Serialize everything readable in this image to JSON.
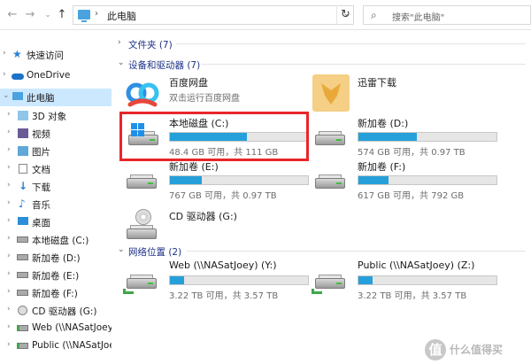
{
  "address_bar": {
    "breadcrumb": "此电脑",
    "search_placeholder": "搜索\"此电脑\""
  },
  "nav": {
    "items": [
      {
        "label": "快速访问",
        "icon": "star-icon"
      },
      {
        "label": "OneDrive",
        "icon": "cloud-icon"
      },
      {
        "label": "此电脑",
        "icon": "computer-icon"
      },
      {
        "label": "3D 对象",
        "icon": "3d-objects-icon"
      },
      {
        "label": "视频",
        "icon": "video-icon"
      },
      {
        "label": "图片",
        "icon": "pictures-icon"
      },
      {
        "label": "文档",
        "icon": "documents-icon"
      },
      {
        "label": "下载",
        "icon": "download-icon"
      },
      {
        "label": "音乐",
        "icon": "music-icon"
      },
      {
        "label": "桌面",
        "icon": "desktop-icon"
      },
      {
        "label": "本地磁盘 (C:)",
        "icon": "drive-icon"
      },
      {
        "label": "新加卷 (D:)",
        "icon": "drive-icon"
      },
      {
        "label": "新加卷 (E:)",
        "icon": "drive-icon"
      },
      {
        "label": "新加卷 (F:)",
        "icon": "drive-icon"
      },
      {
        "label": "CD 驱动器 (G:)",
        "icon": "cd-drive-icon"
      },
      {
        "label": "Web (\\\\NASatJoey",
        "icon": "network-drive-icon"
      },
      {
        "label": "Public (\\\\NASatJoe",
        "icon": "network-drive-icon"
      }
    ]
  },
  "groups": {
    "folders": "文件夹 (7)",
    "devices": "设备和驱动器 (7)",
    "network": "网络位置 (2)"
  },
  "apps": {
    "baidu": {
      "name": "百度网盘",
      "subtitle": "双击运行百度网盘"
    },
    "xunlei": {
      "name": "迅雷下载"
    }
  },
  "drives": {
    "c": {
      "name": "本地磁盘 (C:)",
      "size": "48.4 GB 可用，共 111 GB",
      "used_fraction": 0.56
    },
    "d": {
      "name": "新加卷 (D:)",
      "size": "574 GB 可用，共 0.97 TB",
      "used_fraction": 0.42
    },
    "e": {
      "name": "新加卷 (E:)",
      "size": "767 GB 可用，共 0.97 TB",
      "used_fraction": 0.23
    },
    "f": {
      "name": "新加卷 (F:)",
      "size": "617 GB 可用，共 792 GB",
      "used_fraction": 0.22
    },
    "g": {
      "name": "CD 驱动器 (G:)"
    }
  },
  "network": {
    "web": {
      "name": "Web (\\\\NASatJoey) (Y:)",
      "size": "3.22 TB 可用，共 3.57 TB",
      "used_fraction": 0.1
    },
    "public": {
      "name": "Public (\\\\NASatJoey) (Z:)",
      "size": "3.22 TB 可用，共 3.57 TB",
      "used_fraction": 0.1
    }
  },
  "watermark": {
    "logo": "值",
    "text": "什么值得买"
  },
  "colors": {
    "accent": "#26a0da",
    "selection": "#cce8ff",
    "highlight_box": "#e8262a",
    "group_header": "#1e3287"
  }
}
